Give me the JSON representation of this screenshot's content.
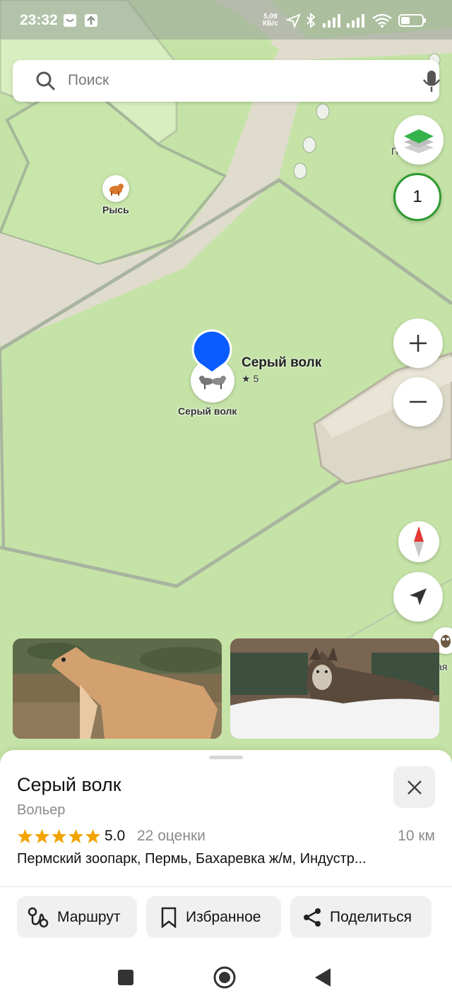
{
  "status_bar": {
    "time": "23:32",
    "speed_value": "5,09",
    "speed_unit": "КБ/с",
    "icons": [
      "notification-icon",
      "upload-icon",
      "location-icon",
      "bluetooth-icon",
      "signal-icon",
      "signal-icon",
      "wifi-icon",
      "battery-icon"
    ]
  },
  "search": {
    "placeholder": "Поиск"
  },
  "map": {
    "layers_count": "1",
    "poi_lynx": {
      "label": "Рысь",
      "icon": "lynx-icon"
    },
    "poi_wolf": {
      "label": "Серый волк",
      "icon": "wolf-icon"
    },
    "selected_pin": {
      "title": "Серый волк",
      "rating": "★ 5"
    },
    "edge_label_top": "П      й",
    "edge_label_right": "ая",
    "colors": {
      "grass": "#c5e3a7",
      "path": "#e0dccd",
      "pin": "#0a5cff",
      "accent_green": "#2d9a2f"
    }
  },
  "photos": [
    "wolf-photo-1",
    "wolf-photo-2"
  ],
  "card": {
    "title": "Серый волк",
    "subtitle": "Вольер",
    "rating_value": "5.0",
    "rating_count": "22 оценки",
    "stars": 5,
    "distance": "10 км",
    "address": "Пермский зоопарк, Пермь, Бахаревка ж/м, Индустр...",
    "star_color": "#f2a400"
  },
  "actions": {
    "route": "Маршрут",
    "favorite": "Избранное",
    "share": "Поделиться"
  }
}
